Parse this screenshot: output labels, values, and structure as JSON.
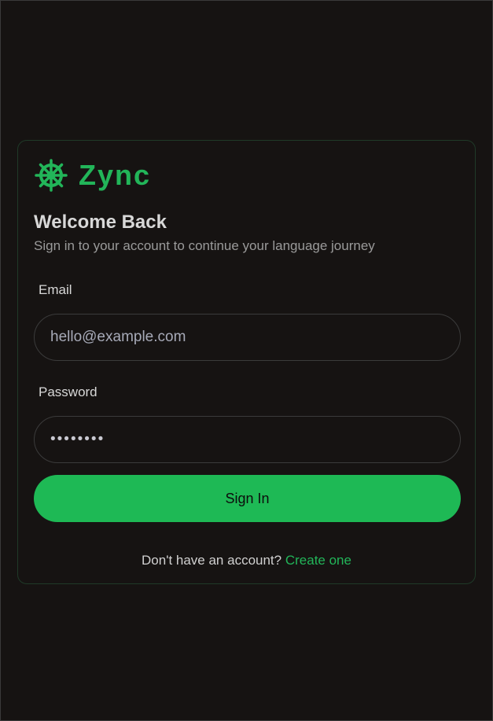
{
  "brand": {
    "name": "Zync",
    "icon": "ship-wheel-icon",
    "color": "#22b559"
  },
  "login": {
    "title": "Welcome Back",
    "subtitle": "Sign in to your account to continue your language journey",
    "email": {
      "label": "Email",
      "placeholder": "hello@example.com",
      "value": ""
    },
    "password": {
      "label": "Password",
      "value": "••••••••"
    },
    "submit_label": "Sign In",
    "footer_text": "Don't have an account?",
    "footer_link": "Create one"
  },
  "colors": {
    "background": "#161312",
    "accent": "#1eb955",
    "card_border": "#1f3a28"
  }
}
